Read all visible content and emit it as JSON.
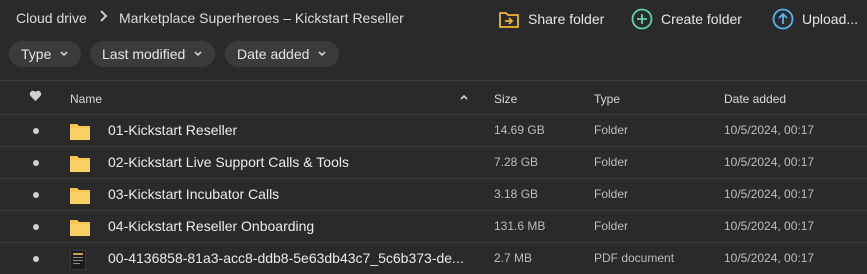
{
  "breadcrumb": {
    "root": "Cloud drive",
    "current": "Marketplace Superheroes – Kickstart Reseller"
  },
  "actions": {
    "share": "Share folder",
    "create": "Create folder",
    "upload": "Upload..."
  },
  "filters": {
    "type": "Type",
    "modified": "Last modified",
    "added": "Date added"
  },
  "columns": {
    "name": "Name",
    "size": "Size",
    "type": "Type",
    "date": "Date added"
  },
  "rows": [
    {
      "name": "01-Kickstart Reseller",
      "size": "14.69 GB",
      "type": "Folder",
      "date": "10/5/2024, 00:17",
      "icon": "folder-icon"
    },
    {
      "name": "02-Kickstart Live Support Calls & Tools",
      "size": "7.28 GB",
      "type": "Folder",
      "date": "10/5/2024, 00:17",
      "icon": "folder-icon"
    },
    {
      "name": "03-Kickstart Incubator Calls",
      "size": "3.18 GB",
      "type": "Folder",
      "date": "10/5/2024, 00:17",
      "icon": "folder-icon"
    },
    {
      "name": "04-Kickstart Reseller Onboarding",
      "size": "131.6 MB",
      "type": "Folder",
      "date": "10/5/2024, 00:17",
      "icon": "folder-icon"
    },
    {
      "name": "00-4136858-81a3-acc8-ddb8-5e63db43c7_5c6b373-de...",
      "size": "2.7 MB",
      "type": "PDF document",
      "date": "10/5/2024, 00:17",
      "icon": "pdf-thumbnail-icon"
    }
  ],
  "colors": {
    "background": "#2a2a2a",
    "chip": "#3b3b3b",
    "folder": "#f5c451",
    "share_icon": "#f2b531",
    "create_icon": "#5fd3a6",
    "upload_icon": "#58b4f0"
  }
}
